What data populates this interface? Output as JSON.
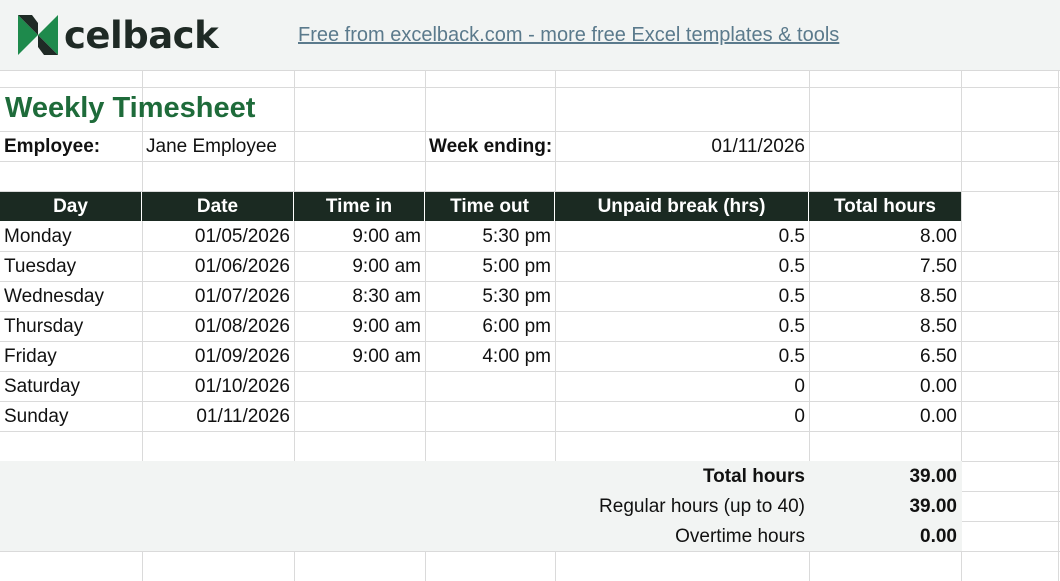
{
  "header": {
    "logo_text": "celback",
    "link_text": "Free from excelback.com - more free Excel templates & tools"
  },
  "sheet": {
    "title": "Weekly Timesheet",
    "employee_label": "Employee:",
    "employee_name": "Jane Employee",
    "week_ending_label": "Week ending:",
    "week_ending": "01/11/2026"
  },
  "table": {
    "columns": [
      "Day",
      "Date",
      "Time in",
      "Time out",
      "Unpaid break (hrs)",
      "Total hours"
    ],
    "rows": [
      {
        "day": "Monday",
        "date": "01/05/2026",
        "time_in": "9:00 am",
        "time_out": "5:30 pm",
        "break": "0.5",
        "total": "8.00"
      },
      {
        "day": "Tuesday",
        "date": "01/06/2026",
        "time_in": "9:00 am",
        "time_out": "5:00 pm",
        "break": "0.5",
        "total": "7.50"
      },
      {
        "day": "Wednesday",
        "date": "01/07/2026",
        "time_in": "8:30 am",
        "time_out": "5:30 pm",
        "break": "0.5",
        "total": "8.50"
      },
      {
        "day": "Thursday",
        "date": "01/08/2026",
        "time_in": "9:00 am",
        "time_out": "6:00 pm",
        "break": "0.5",
        "total": "8.50"
      },
      {
        "day": "Friday",
        "date": "01/09/2026",
        "time_in": "9:00 am",
        "time_out": "4:00 pm",
        "break": "0.5",
        "total": "6.50"
      },
      {
        "day": "Saturday",
        "date": "01/10/2026",
        "time_in": "",
        "time_out": "",
        "break": "0",
        "total": "0.00"
      },
      {
        "day": "Sunday",
        "date": "01/11/2026",
        "time_in": "",
        "time_out": "",
        "break": "0",
        "total": "0.00"
      }
    ]
  },
  "summary": {
    "total_label": "Total hours",
    "total_value": "39.00",
    "regular_label": "Regular hours (up to 40)",
    "regular_value": "39.00",
    "overtime_label": "Overtime hours",
    "overtime_value": "0.00"
  },
  "colors": {
    "title_green": "#1e6b3a",
    "header_dark": "#1b2a22",
    "band_gray": "#f2f4f3",
    "link_blue": "#5b7a8c",
    "logo_green": "#1e8a4c"
  }
}
